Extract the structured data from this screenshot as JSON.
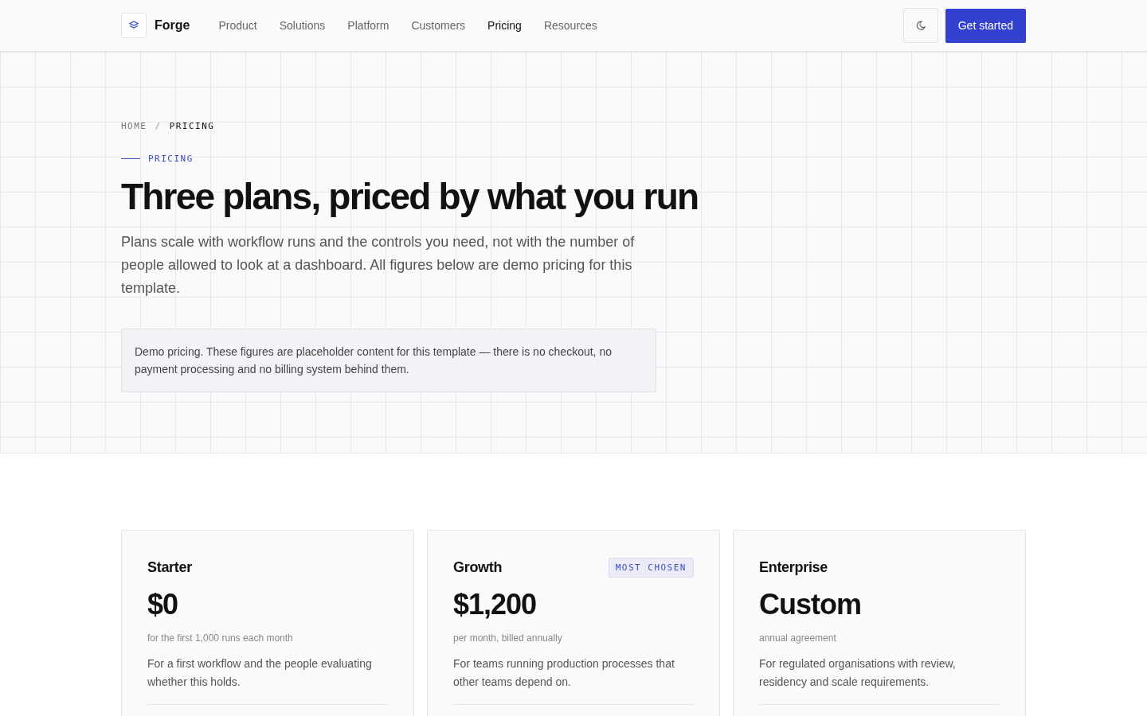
{
  "brand": {
    "name": "Forge"
  },
  "nav": [
    {
      "label": "Product",
      "selected": false
    },
    {
      "label": "Solutions",
      "selected": false
    },
    {
      "label": "Platform",
      "selected": false
    },
    {
      "label": "Customers",
      "selected": false
    },
    {
      "label": "Pricing",
      "selected": true
    },
    {
      "label": "Resources",
      "selected": false
    }
  ],
  "cta": "Get started",
  "breadcrumb": [
    {
      "label": "HOME",
      "current": false
    },
    {
      "label": "PRICING",
      "current": true
    }
  ],
  "breadcrumb_separator": "/",
  "eyebrow": "PRICING",
  "title": "Three plans, priced by what you run",
  "intro": "Plans scale with workflow runs and the controls you need, not with the number of people allowed to look at a dashboard. All figures below are demo pricing for this template.",
  "notice": "Demo pricing. These figures are placeholder content for this template — there is no checkout, no payment processing and no billing system behind them.",
  "plans": [
    {
      "name": "Starter",
      "price": "$0",
      "period": "for the first 1,000 runs each month",
      "description": "For a first workflow and the people evaluating whether this holds."
    },
    {
      "name": "Growth",
      "badge": "MOST CHOSEN",
      "price": "$1,200",
      "period": "per month, billed annually",
      "description": "For teams running production processes that other teams depend on."
    },
    {
      "name": "Enterprise",
      "price": "Custom",
      "period": "annual agreement",
      "description": "For regulated organisations with review, residency and scale requirements."
    }
  ]
}
